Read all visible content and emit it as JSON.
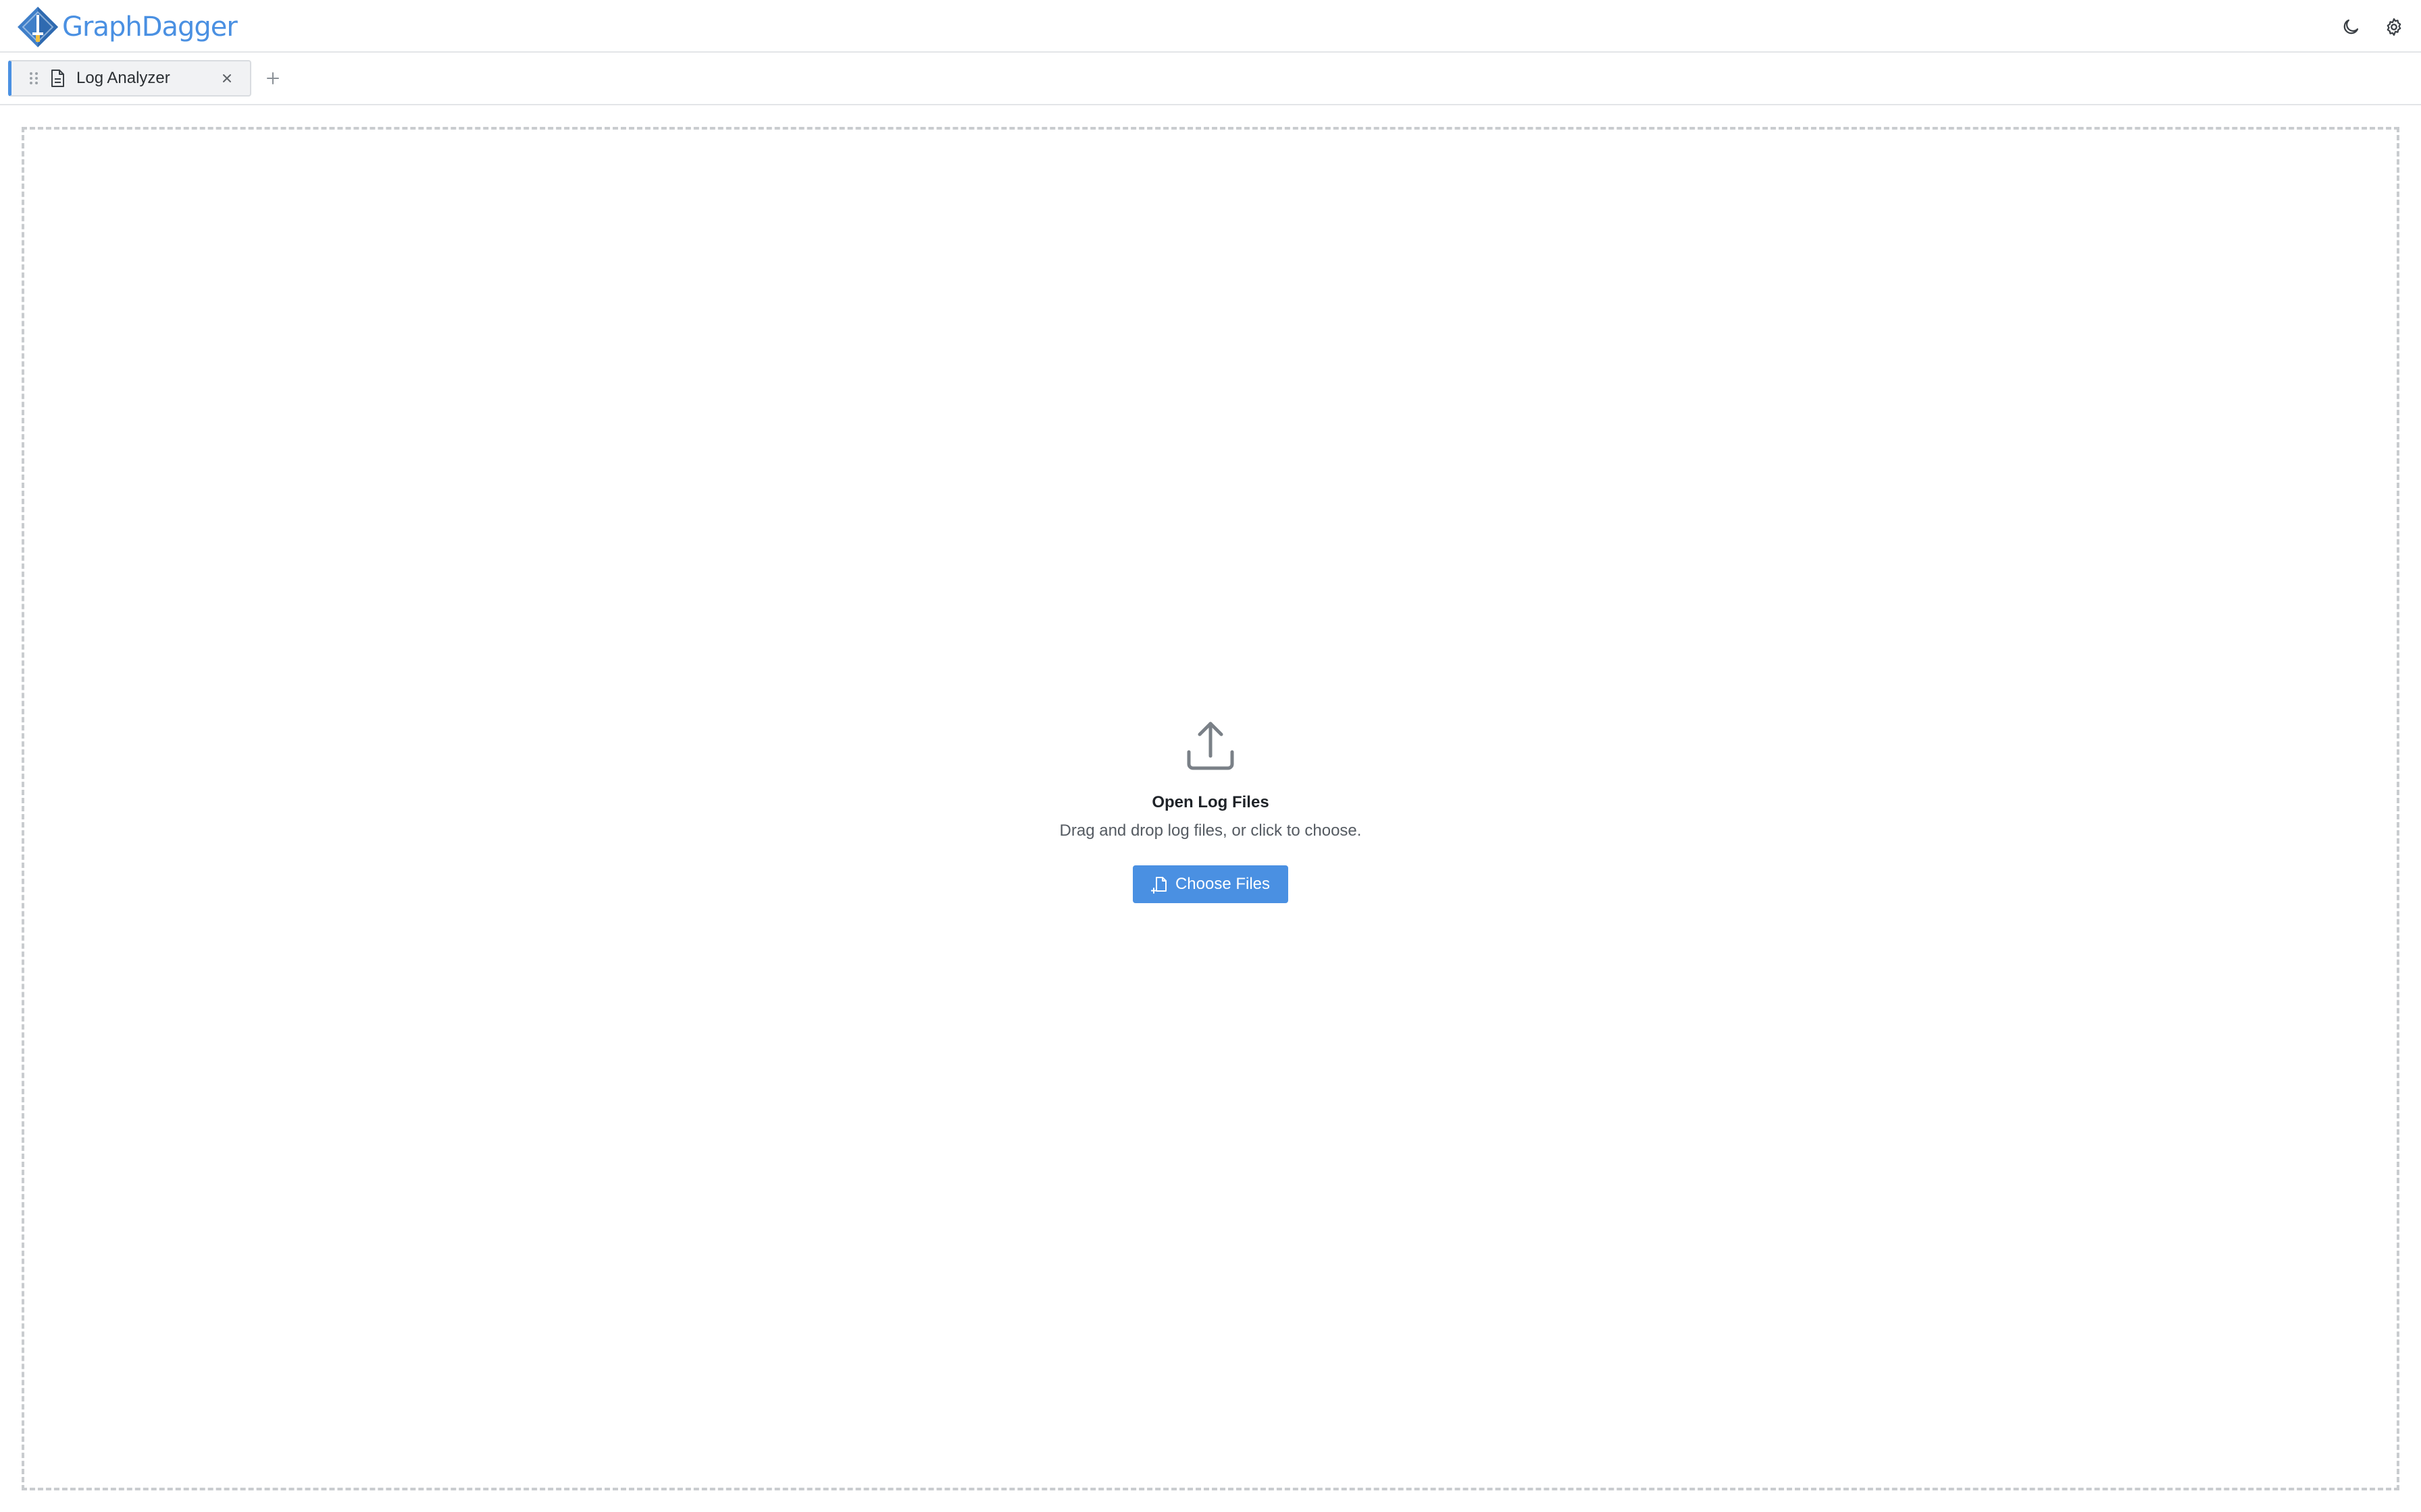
{
  "app": {
    "name": "GraphDagger",
    "logo_icon": "diamond-dagger-logo",
    "accent_color": "#4a90e2"
  },
  "header": {
    "actions": [
      {
        "icon": "moon-icon",
        "label": "Toggle dark mode"
      },
      {
        "icon": "gear-icon",
        "label": "Settings"
      }
    ]
  },
  "tabs": [
    {
      "label": "Log Analyzer",
      "icon": "document-icon",
      "active": true,
      "closable": true
    }
  ],
  "tab_bar": {
    "add_icon": "plus-icon"
  },
  "drop_zone": {
    "icon": "upload-icon",
    "title": "Open Log Files",
    "subtitle": "Drag and drop log files, or click to choose.",
    "button_label": "Choose Files",
    "button_icon": "file-add-icon"
  },
  "colors": {
    "button_bg": "#4a90e2",
    "button_text": "#ffffff",
    "border": "#e3e5e8",
    "dashed_border": "#c9cccf"
  }
}
